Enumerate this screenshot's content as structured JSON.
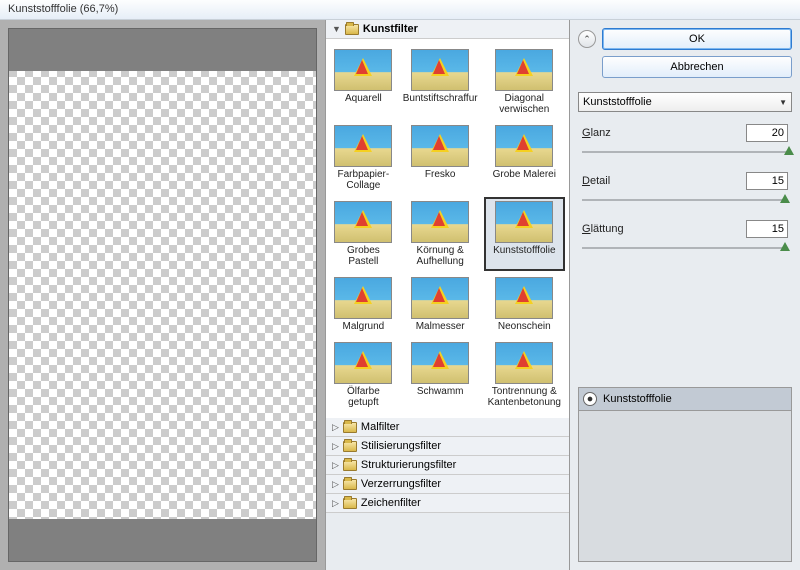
{
  "title": "Kunststofffolie (66,7%)",
  "filters": {
    "open_category": "Kunstfilter",
    "thumbs": [
      {
        "label": "Aquarell"
      },
      {
        "label": "Buntstiftschraffur"
      },
      {
        "label": "Diagonal verwischen"
      },
      {
        "label": "Farbpapier-Collage"
      },
      {
        "label": "Fresko"
      },
      {
        "label": "Grobe Malerei"
      },
      {
        "label": "Grobes Pastell"
      },
      {
        "label": "Körnung & Aufhellung"
      },
      {
        "label": "Kunststofffolie",
        "selected": true
      },
      {
        "label": "Malgrund"
      },
      {
        "label": "Malmesser"
      },
      {
        "label": "Neonschein"
      },
      {
        "label": "Ölfarbe getupft"
      },
      {
        "label": "Schwamm"
      },
      {
        "label": "Tontrennung & Kantenbetonung"
      }
    ],
    "closed_categories": [
      "Malfilter",
      "Stilisierungsfilter",
      "Strukturierungsfilter",
      "Verzerrungsfilter",
      "Zeichenfilter"
    ]
  },
  "buttons": {
    "ok": "OK",
    "cancel": "Abbrechen"
  },
  "dropdown": {
    "selected": "Kunststofffolie"
  },
  "params": [
    {
      "label": "Glanz",
      "value": "20",
      "pos": 98
    },
    {
      "label": "Detail",
      "value": "15",
      "pos": 96
    },
    {
      "label": "Glättung",
      "value": "15",
      "pos": 96
    }
  ],
  "layer": {
    "name": "Kunststofffolie"
  },
  "chart_data": null
}
